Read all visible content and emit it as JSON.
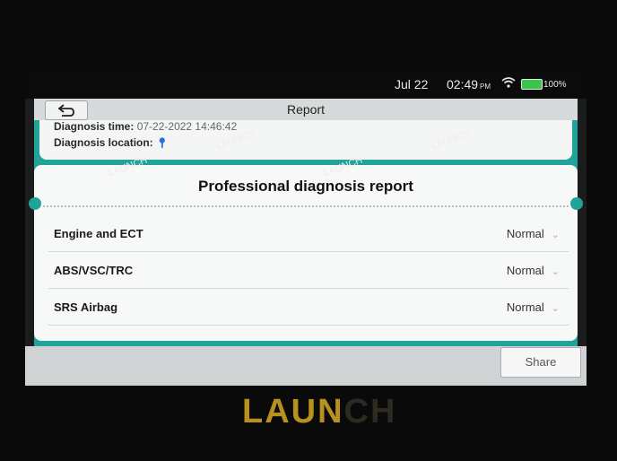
{
  "status": {
    "date": "Jul 22",
    "time": "02:49",
    "ampm": "PM",
    "battery": "100%"
  },
  "header": {
    "title": "Report"
  },
  "info": {
    "time_label": "Diagnosis time:",
    "time_value": "07-22-2022 14:46:42",
    "location_label": "Diagnosis location:"
  },
  "report": {
    "title": "Professional diagnosis report",
    "rows": [
      {
        "label": "Engine and ECT",
        "status": "Normal"
      },
      {
        "label": "ABS/VSC/TRC",
        "status": "Normal"
      },
      {
        "label": "SRS Airbag",
        "status": "Normal"
      }
    ]
  },
  "footer": {
    "share_label": "Share"
  },
  "device": {
    "logo_a": "LAUN",
    "logo_b": "CH"
  },
  "watermark": "LAUNCH",
  "colors": {
    "accent": "#22a39a",
    "battery": "#39c54a"
  }
}
